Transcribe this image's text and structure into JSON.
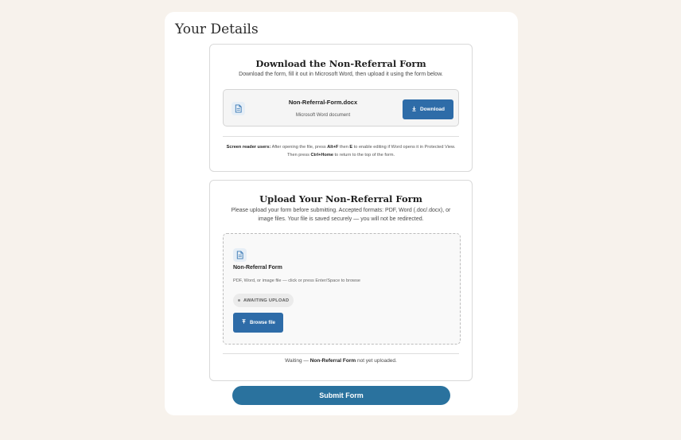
{
  "page": {
    "title": "Your Details"
  },
  "download_section": {
    "title": "Download the Non-Referral Form",
    "description": "Download the form, fill it out in Microsoft Word, then upload it using the form below.",
    "file": {
      "name": "Non-Referral-Form.docx",
      "type": "Microsoft Word document",
      "icon": "document-icon"
    },
    "download_label": "Download",
    "download_icon": "download-arrow-icon",
    "screen_reader_note": {
      "label": "Screen reader users:",
      "text_1": "After opening the file, press",
      "key_1": "Alt+F",
      "text_2": "then",
      "key_2": "E",
      "text_3": "to enable editing if Word opens it in Protected View. Then press",
      "key_3": "Ctrl+Home",
      "text_4": "to return to the top of the form."
    }
  },
  "upload_section": {
    "title": "Upload Your Non-Referral Form",
    "description": "Please upload your form before submitting. Accepted formats: PDF, Word (.doc/.docx), or image files. Your file is saved securely — you will not be redirected.",
    "dropzone": {
      "icon": "document-icon",
      "title": "Non-Referral Form",
      "hint": "PDF, Word, or image file — click or press Enter/Space to browse",
      "status": "AWAITING UPLOAD",
      "browse_label": "Browse file",
      "browse_icon": "upload-arrow-icon"
    },
    "status_line": {
      "prefix": "Waiting —",
      "name": "Non-Referral Form",
      "suffix": "not yet uploaded."
    }
  },
  "submit_label": "Submit Form",
  "colors": {
    "background": "#f7f2ec",
    "primary_button": "#2e6ca8",
    "submit_button": "#2a729e"
  }
}
